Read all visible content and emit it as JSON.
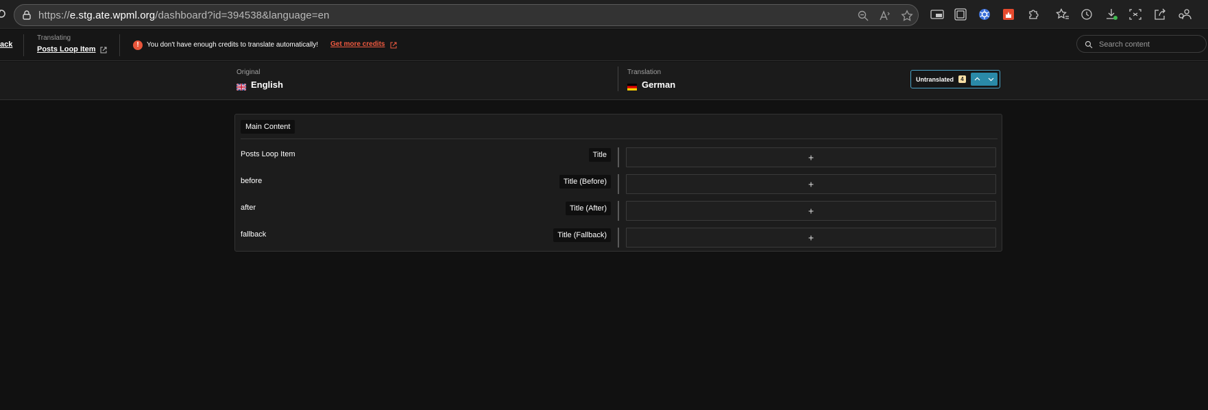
{
  "browser": {
    "url_scheme": "https://",
    "url_host": "e.stg.ate.wpml.org",
    "url_path": "/dashboard?id=394538&language=en"
  },
  "header": {
    "back_label": "ack",
    "translating_label": "Translating",
    "document_title": "Posts Loop Item",
    "warning_text": "You don't have enough credits to translate automatically!",
    "credits_link": "Get more credits",
    "search_placeholder": "Search content"
  },
  "languages": {
    "original_label": "Original",
    "original_name": "English",
    "translation_label": "Translation",
    "translation_name": "German",
    "filter_label": "Untranslated",
    "filter_count": "4"
  },
  "main": {
    "section_title": "Main Content",
    "rows": [
      {
        "text": "Posts Loop Item",
        "tag": "Title",
        "action": "+"
      },
      {
        "text": "before",
        "tag": "Title (Before)",
        "action": "+"
      },
      {
        "text": "after",
        "tag": "Title (After)",
        "action": "+"
      },
      {
        "text": "fallback",
        "tag": "Title (Fallback)",
        "action": "+"
      }
    ]
  },
  "colors": {
    "accent": "#2a8aa8",
    "warning": "#e8553a",
    "background": "#111111"
  }
}
